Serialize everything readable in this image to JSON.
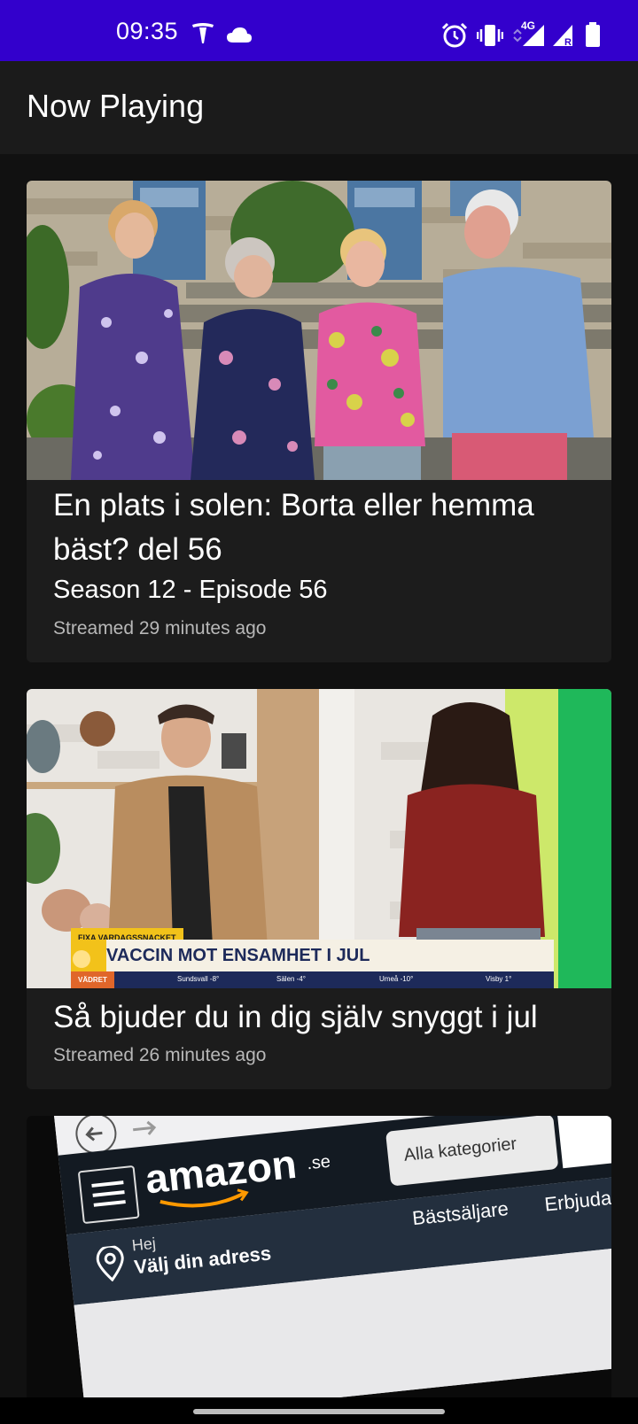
{
  "status_bar": {
    "time": "09:35",
    "background": "#3300cc",
    "left_icons": [
      "tesla-icon",
      "cloud-icon"
    ],
    "right_icons": [
      "alarm-icon",
      "vibrate-icon",
      "signal-4g-icon",
      "signal-roaming-icon",
      "battery-icon"
    ],
    "network_label": "4G",
    "roaming_label": "R"
  },
  "app_bar": {
    "title": "Now Playing"
  },
  "items": [
    {
      "title": "En plats i solen: Borta eller hemma bäst? del 56",
      "subtitle": "Season 12 - Episode 56",
      "meta": "Streamed 29 minutes ago"
    },
    {
      "title": "Så bjuder du in dig själv snyggt i jul",
      "meta": "Streamed 26 minutes ago",
      "thumb_caption_small": "FIXA VARDAGSSNACKET",
      "thumb_caption": "VACCIN MOT ENSAMHET I JUL",
      "thumb_ticker_label": "VÄDRET",
      "thumb_ticker": [
        "Sundsvall -8°",
        "Sälen -4°",
        "Umeå -10°",
        "Visby 1°"
      ]
    },
    {
      "thumb_logo": "amazon",
      "thumb_logo_suffix": ".se",
      "thumb_dropdown": "Alla kategorier",
      "thumb_greeting": "Hej",
      "thumb_address": "Välj din adress",
      "thumb_nav_1": "Bästsäljare",
      "thumb_nav_2": "Erbjudan"
    }
  ]
}
